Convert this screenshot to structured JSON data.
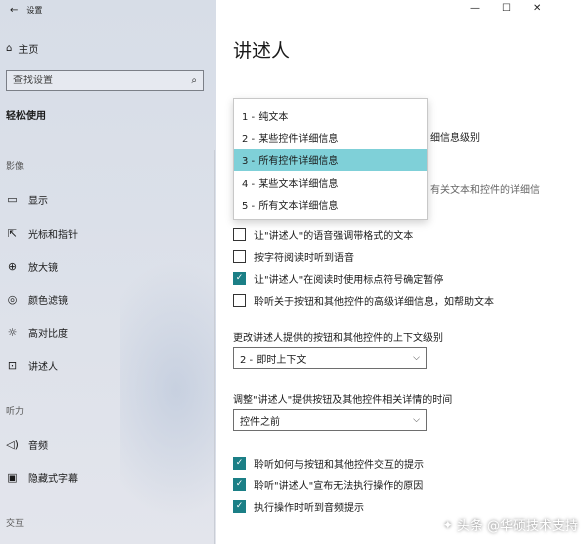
{
  "window": {
    "title": "设置",
    "controls": {
      "minimize": "—",
      "maximize": "☐",
      "close": "✕"
    }
  },
  "sidebar": {
    "home": "主页",
    "search_placeholder": "查找设置",
    "section": "轻松使用",
    "groups": [
      {
        "label": "影像",
        "items": [
          "显示",
          "光标和指针",
          "放大镜",
          "颜色滤镜",
          "高对比度",
          "讲述人"
        ]
      },
      {
        "label": "听力",
        "items": [
          "音频",
          "隐藏式字幕"
        ]
      },
      {
        "label": "交互"
      }
    ]
  },
  "main": {
    "title": "讲述人",
    "partial_right_1": "细信息级别",
    "partial_right_2": "有关文本和控件的详细信",
    "dropdown_options": [
      "1 - 纯文本",
      "2 - 某些控件详细信息",
      "3 - 所有控件详细信息",
      "4 - 某些文本详细信息",
      "5 - 所有文本详细信息"
    ],
    "dropdown_selected_index": 2,
    "checkboxes_1": [
      {
        "label": "让\"讲述人\"的语音强调带格式的文本",
        "checked": false
      },
      {
        "label": "按字符阅读时听到语音",
        "checked": false
      },
      {
        "label": "让\"讲述人\"在阅读时使用标点符号确定暂停",
        "checked": true
      },
      {
        "label": "聆听关于按钮和其他控件的高级详细信息，如帮助文本",
        "checked": false
      }
    ],
    "context_label": "更改讲述人提供的按钮和其他控件的上下文级别",
    "context_value": "2 - 即时上下文",
    "timing_label": "调整\"讲述人\"提供按钮及其他控件相关详情的时间",
    "timing_value": "控件之前",
    "checkboxes_2": [
      {
        "label": "聆听如何与按钮和其他控件交互的提示",
        "checked": true
      },
      {
        "label": "聆听\"讲述人\"宣布无法执行操作的原因",
        "checked": true
      },
      {
        "label": "执行操作时听到音频提示",
        "checked": true
      }
    ]
  },
  "watermark": "头条 @华硕技术支持"
}
